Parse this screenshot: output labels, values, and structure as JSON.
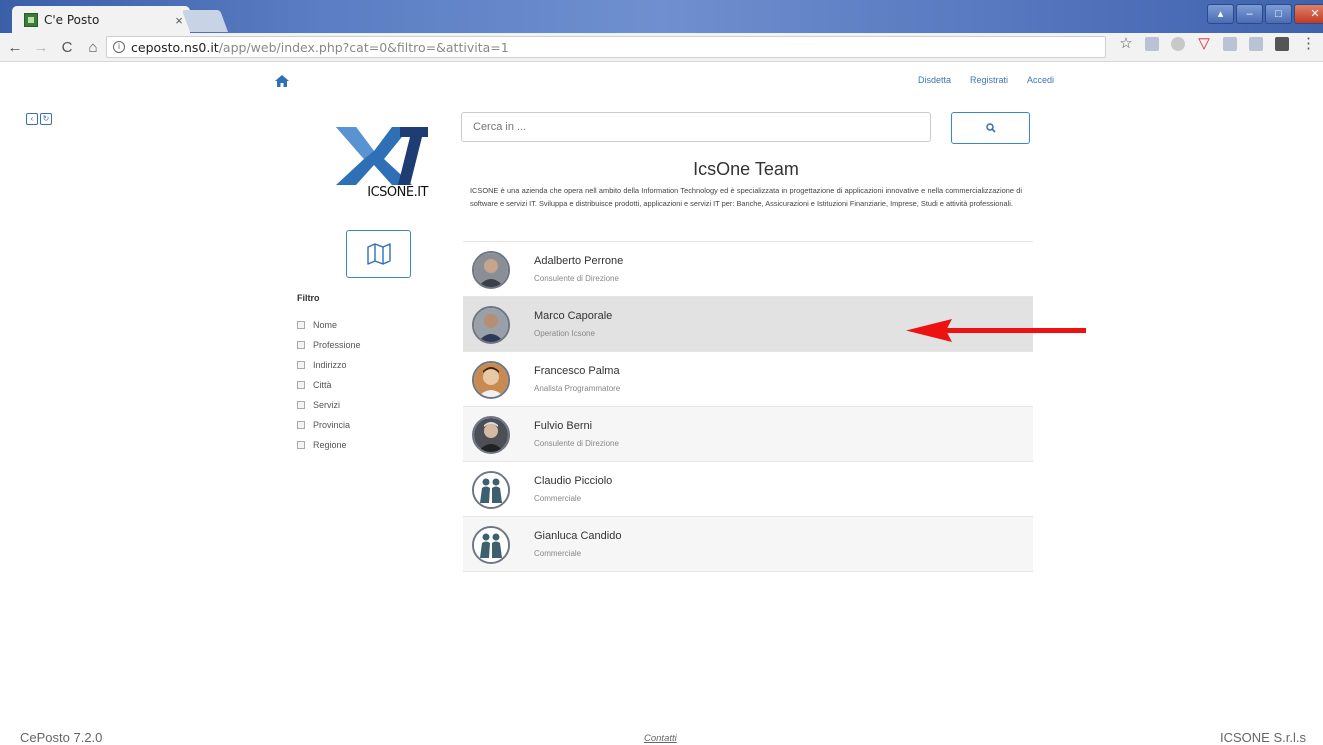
{
  "browser": {
    "tab_title": "C'e Posto",
    "tab_close": "×",
    "url_host": "ceposto.ns0.it",
    "url_path": "/app/web/index.php?cat=0&filtro=&attivita=1",
    "back": "←",
    "forward": "→",
    "reload": "C",
    "home": "⌂",
    "star": "☆",
    "menu": "⋮"
  },
  "header": {
    "links": [
      "Disdetta",
      "Registrati",
      "Accedi"
    ]
  },
  "logo": {
    "text": "ICSONE.IT",
    "brand_colors": {
      "blue": "#2f6fb5",
      "navy": "#1d3d73"
    }
  },
  "filter": {
    "title": "Filtro",
    "options": [
      "Nome",
      "Professione",
      "Indirizzo",
      "Città",
      "Servizi",
      "Provincia",
      "Regione"
    ]
  },
  "search": {
    "placeholder": "Cerca in ..."
  },
  "team": {
    "title": "IcsOne Team",
    "description": "ICSONE è una azienda che opera nell ambito della Information Technology ed è specializzata in progettazione di applicazioni innovative e nella commercializzazione di software e servizi IT. Sviluppa e distribuisce prodotti, applicazioni e servizi IT per: Banche, Assicurazioni e Istituzioni Finanziarie, Imprese, Studi e attività professionali.",
    "members": [
      {
        "name": "Adalberto Perrone",
        "role": "Consulente di Direzione",
        "avatar": "photo"
      },
      {
        "name": "Marco Caporale",
        "role": "Operation Icsone",
        "avatar": "photo",
        "selected": true
      },
      {
        "name": "Francesco Palma",
        "role": "Analista Programmatore",
        "avatar": "photo"
      },
      {
        "name": "Fulvio Berni",
        "role": "Consulente di Direzione",
        "avatar": "photo"
      },
      {
        "name": "Claudio Picciolo",
        "role": "Commerciale",
        "avatar": "placeholder"
      },
      {
        "name": "Gianluca Candido",
        "role": "Commerciale",
        "avatar": "placeholder"
      }
    ]
  },
  "annotation": {
    "arrow_color": "#ee1111",
    "points_to": "Marco Caporale"
  },
  "footer": {
    "version": "CePosto 7.2.0",
    "contact": "Contatti",
    "company": "ICSONE S.r.l.s"
  }
}
